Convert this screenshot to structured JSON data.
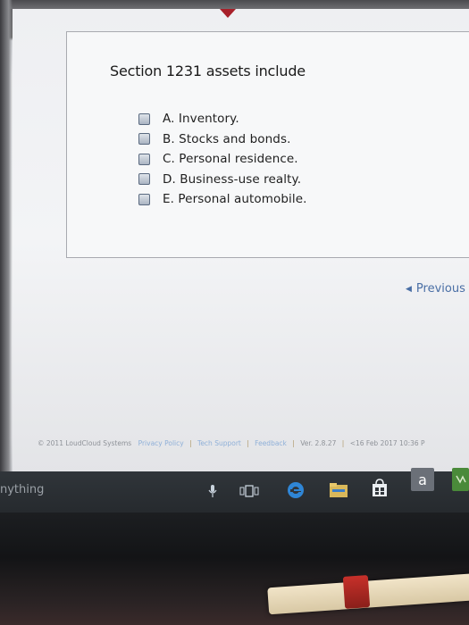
{
  "question": {
    "title": "Section 1231 assets include",
    "options": [
      {
        "label": "A. Inventory.",
        "checked": false
      },
      {
        "label": "B. Stocks and bonds.",
        "checked": false
      },
      {
        "label": "C. Personal residence.",
        "checked": false
      },
      {
        "label": "D. Business-use realty.",
        "checked": false
      },
      {
        "label": "E. Personal automobile.",
        "checked": false
      }
    ]
  },
  "navigation": {
    "previous_label": "Previous",
    "separator": "|"
  },
  "footer": {
    "copyright": "© 2011 LoudCloud Systems",
    "privacy_label": "Privacy Policy",
    "tech_support_label": "Tech Support",
    "feedback_label": "Feedback",
    "version": "Ver. 2.8.27",
    "date": "<16 Feb 2017 10:36 P",
    "separator": "|"
  },
  "taskbar": {
    "search_text": "nything",
    "icons": [
      "microphone-icon",
      "task-view-icon",
      "edge-browser-icon",
      "file-explorer-icon",
      "store-icon",
      "amazon-icon",
      "app-icon"
    ],
    "amazon_letter": "a"
  },
  "colors": {
    "accent": "#a8202a",
    "link": "#4a6fa5",
    "footer_link": "#8fb0d8"
  }
}
